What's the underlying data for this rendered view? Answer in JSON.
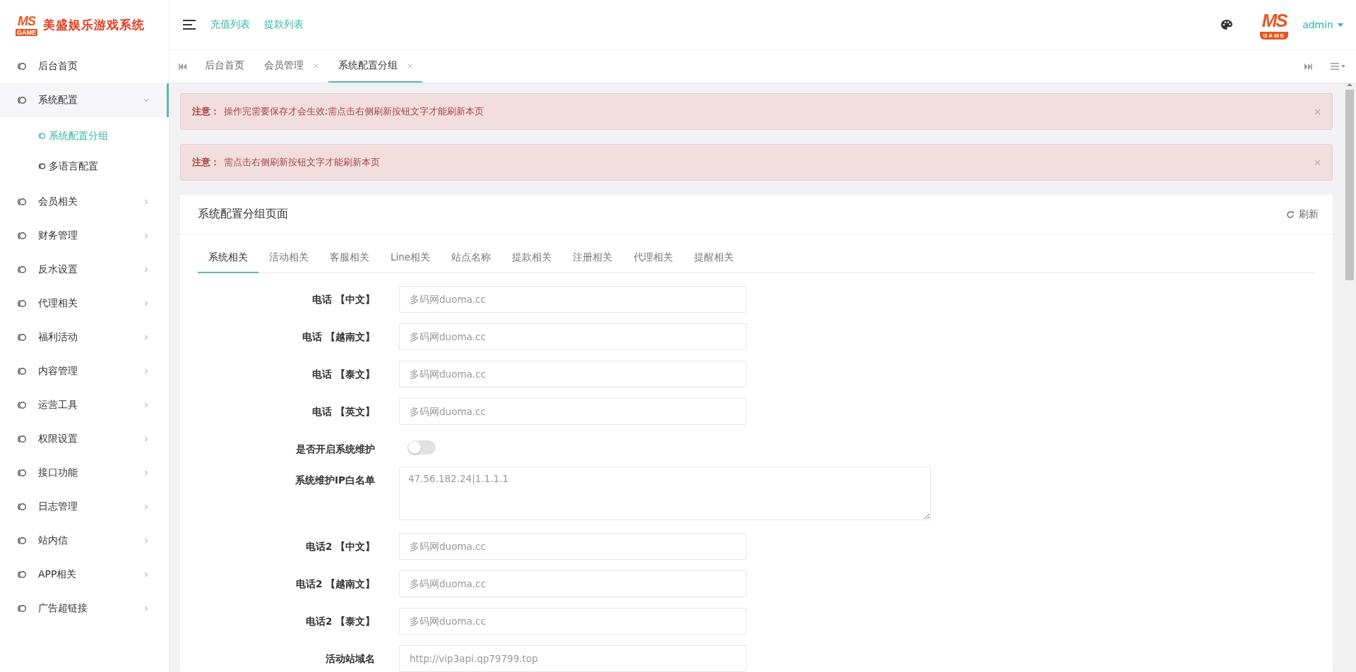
{
  "brand": {
    "logo_top": "MS",
    "logo_bottom": "GAME",
    "title": "美盛娱乐游戏系统"
  },
  "header": {
    "links": [
      "充值列表",
      "提款列表"
    ],
    "avatar": {
      "top": "MS",
      "bottom": "GAME"
    },
    "user": "admin"
  },
  "sidebar": {
    "items": [
      {
        "label": "后台首页",
        "selected": false,
        "has_submenu": false
      },
      {
        "label": "系统配置",
        "selected": true,
        "expanded": true,
        "has_submenu": true,
        "children": [
          {
            "label": "系统配置分组",
            "selected": true
          },
          {
            "label": "多语言配置",
            "selected": false
          }
        ]
      },
      {
        "label": "会员相关",
        "selected": false,
        "expanded": false,
        "has_submenu": true
      },
      {
        "label": "财务管理",
        "selected": false,
        "expanded": false,
        "has_submenu": true
      },
      {
        "label": "反水设置",
        "selected": false,
        "expanded": false,
        "has_submenu": true
      },
      {
        "label": "代理相关",
        "selected": false,
        "expanded": false,
        "has_submenu": true
      },
      {
        "label": "福利活动",
        "selected": false,
        "expanded": false,
        "has_submenu": true
      },
      {
        "label": "内容管理",
        "selected": false,
        "expanded": false,
        "has_submenu": true
      },
      {
        "label": "运营工具",
        "selected": false,
        "expanded": false,
        "has_submenu": true
      },
      {
        "label": "权限设置",
        "selected": false,
        "expanded": false,
        "has_submenu": true
      },
      {
        "label": "接口功能",
        "selected": false,
        "expanded": false,
        "has_submenu": true
      },
      {
        "label": "日志管理",
        "selected": false,
        "expanded": false,
        "has_submenu": true
      },
      {
        "label": "站内信",
        "selected": false,
        "expanded": false,
        "has_submenu": true
      },
      {
        "label": "APP相关",
        "selected": false,
        "expanded": false,
        "has_submenu": true
      },
      {
        "label": "广告超链接",
        "selected": false,
        "expanded": false,
        "has_submenu": true
      }
    ]
  },
  "page_tabs": [
    {
      "label": "后台首页",
      "selected": false,
      "closable": false
    },
    {
      "label": "会员管理",
      "selected": false,
      "closable": true
    },
    {
      "label": "系统配置分组",
      "selected": true,
      "closable": true
    }
  ],
  "alerts": [
    {
      "title": "注意：",
      "text": "操作完需要保存才会生效;需点击右侧刷新按钮文字才能刷新本页"
    },
    {
      "title": "注意：",
      "text": "需点击右侧刷新按钮文字才能刷新本页"
    }
  ],
  "card": {
    "title": "系统配置分组页面",
    "refresh": "刷新",
    "tabs": [
      {
        "label": "系统相关",
        "selected": true
      },
      {
        "label": "活动相关",
        "selected": false
      },
      {
        "label": "客服相关",
        "selected": false
      },
      {
        "label": "Line相关",
        "selected": false
      },
      {
        "label": "站点名称",
        "selected": false
      },
      {
        "label": "提款相关",
        "selected": false
      },
      {
        "label": "注册相关",
        "selected": false
      },
      {
        "label": "代理相关",
        "selected": false
      },
      {
        "label": "提醒相关",
        "selected": false
      }
    ],
    "fields": [
      {
        "kind": "input",
        "label": "电话 【中文】",
        "placeholder": "多码网duoma.cc"
      },
      {
        "kind": "input",
        "label": "电话 【越南文】",
        "placeholder": "多码网duoma.cc"
      },
      {
        "kind": "input",
        "label": "电话 【泰文】",
        "placeholder": "多码网duoma.cc"
      },
      {
        "kind": "input",
        "label": "电话 【英文】",
        "placeholder": "多码网duoma.cc"
      },
      {
        "kind": "switch",
        "label": "是否开启系统维护",
        "on": false
      },
      {
        "kind": "textarea",
        "label": "系统维护IP白名单",
        "placeholder": "47.56.182.24|1.1.1.1"
      },
      {
        "kind": "input",
        "label": "电话2 【中文】",
        "placeholder": "多码网duoma.cc"
      },
      {
        "kind": "input",
        "label": "电话2 【越南文】",
        "placeholder": "多码网duoma.cc"
      },
      {
        "kind": "input",
        "label": "电话2 【泰文】",
        "placeholder": "多码网duoma.cc"
      },
      {
        "kind": "input",
        "label": "活动站域名",
        "placeholder": "http://vip3api.qp79799.top"
      }
    ]
  }
}
